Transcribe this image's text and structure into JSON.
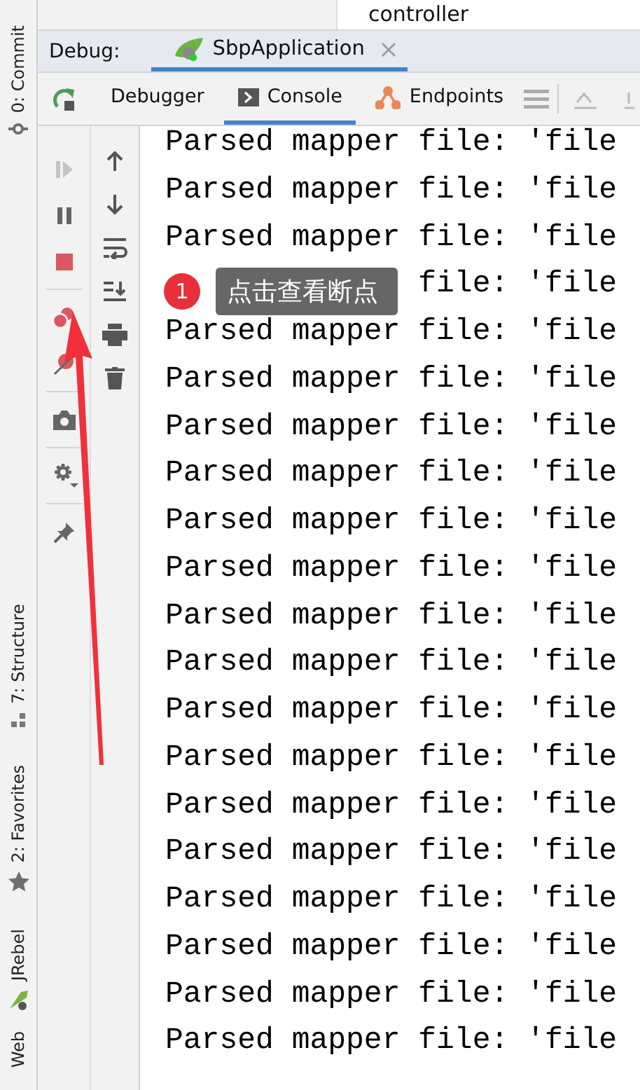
{
  "project_tree": {
    "item": "controller"
  },
  "left_stripe": [
    {
      "label": "0: Commit",
      "kind": "commit"
    },
    {
      "label": "7: Structure",
      "kind": "structure"
    },
    {
      "label": "2: Favorites",
      "kind": "favorites"
    },
    {
      "label": "JRebel",
      "kind": "jrebel"
    },
    {
      "label": "Web",
      "kind": "web"
    }
  ],
  "debug_bar": {
    "title": "Debug:",
    "tabs": [
      {
        "label": "SbpApplication",
        "selected": true
      }
    ]
  },
  "tool_tabs": [
    {
      "label": "Debugger",
      "kind": "debugger",
      "selected": false
    },
    {
      "label": "Console",
      "kind": "console",
      "selected": true
    },
    {
      "label": "Endpoints",
      "kind": "endpoints",
      "selected": false
    }
  ],
  "debug_actions": [
    {
      "kind": "resume",
      "disabled": true
    },
    {
      "kind": "pause",
      "disabled": false
    },
    {
      "kind": "stop",
      "disabled": false
    },
    {
      "kind": "breakpoints",
      "disabled": false
    },
    {
      "kind": "mute",
      "disabled": false
    },
    {
      "kind": "camera",
      "disabled": false
    },
    {
      "kind": "settings",
      "disabled": false
    },
    {
      "kind": "pin",
      "disabled": false
    }
  ],
  "console_actions": [
    {
      "kind": "up"
    },
    {
      "kind": "down"
    },
    {
      "kind": "wrap"
    },
    {
      "kind": "scroll-end"
    },
    {
      "kind": "print"
    },
    {
      "kind": "trash"
    }
  ],
  "console_lines": [
    "Parsed mapper file: 'file",
    "Parsed mapper file: 'file",
    "Parsed mapper file: 'file",
    "file: 'file",
    "Parsed mapper file: 'file",
    "Parsed mapper file: 'file",
    "Parsed mapper file: 'file",
    "Parsed mapper file: 'file",
    "Parsed mapper file: 'file",
    "Parsed mapper file: 'file",
    "Parsed mapper file: 'file",
    "Parsed mapper file: 'file",
    "Parsed mapper file: 'file",
    "Parsed mapper file: 'file",
    "Parsed mapper file: 'file",
    "Parsed mapper file: 'file",
    "Parsed mapper file: 'file",
    "Parsed mapper file: 'file",
    "Parsed mapper file: 'file",
    "Parsed mapper file: 'file"
  ],
  "annotation": {
    "badge": "1",
    "tooltip": "点击查看断点"
  }
}
